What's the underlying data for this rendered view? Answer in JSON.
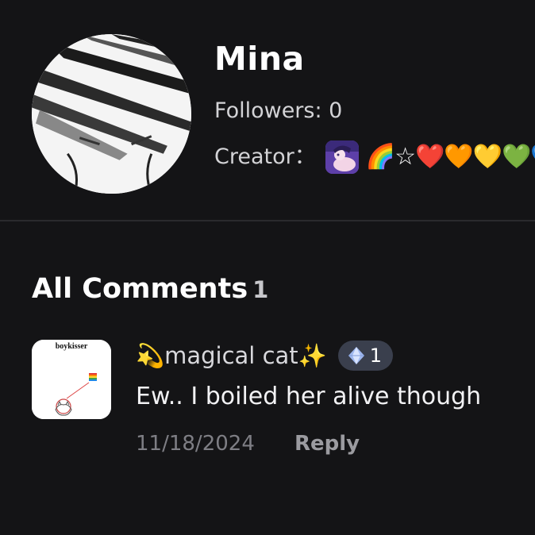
{
  "profile": {
    "name": "Mina",
    "followers_text": "Followers: 0",
    "creator_label": "Creator：",
    "creator_badges": "🌈☆❤️🧡💛💚💙"
  },
  "comments_section": {
    "heading": "All Comments",
    "count": "1"
  },
  "comment": {
    "username": "💫magical cat✨",
    "level": "1",
    "text": "Ew.. I boiled her alive though",
    "date": "11/18/2024",
    "reply_label": "Reply",
    "avatar_caption": "boykisser"
  },
  "colors": {
    "background": "#141416",
    "badge_bg": "#3a3f4d",
    "muted_text": "#7e7e84"
  }
}
